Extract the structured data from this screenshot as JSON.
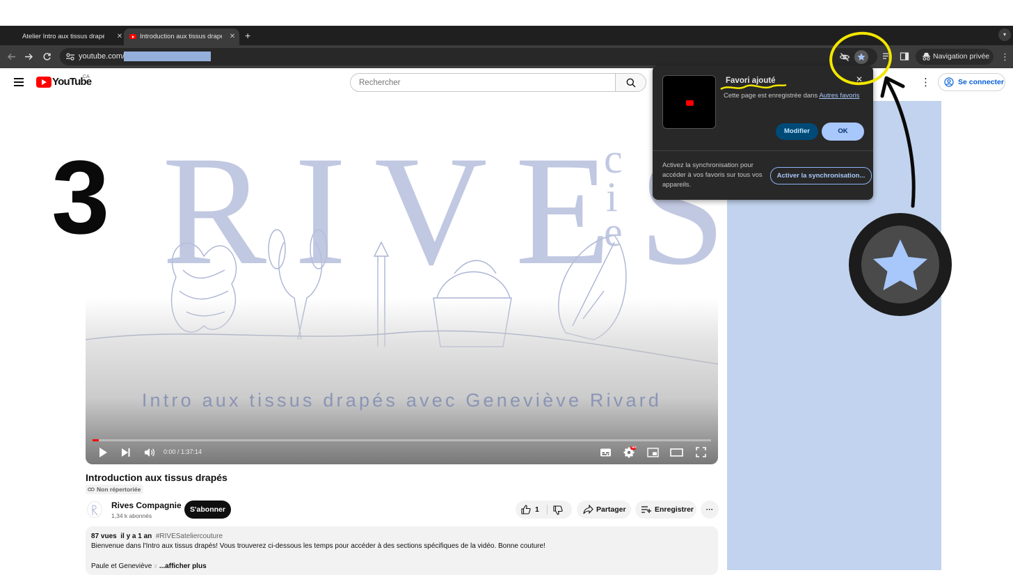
{
  "browser": {
    "tabs": [
      {
        "title": "Atelier Intro aux tissus drapés",
        "close": "✕"
      },
      {
        "title": "Introduction aux tissus drapés",
        "close": "✕"
      }
    ],
    "new_tab": "+",
    "url": "youtube.com/",
    "private_label": "Navigation privée"
  },
  "youtube": {
    "wordmark": "YouTube",
    "country": "CA",
    "search_placeholder": "Rechercher",
    "signin_label": "Se connecter"
  },
  "annotation": {
    "step_number": "3"
  },
  "player": {
    "subtitle_overlay": "Intro aux tissus drapés avec Geneviève Rivard",
    "watermark_word": "RIVES",
    "watermark_suffix": "cie",
    "time": "0:00 / 1:37:14",
    "progress_fraction": 0.01,
    "quality_badge": "HD"
  },
  "video": {
    "title": "Introduction aux tissus drapés",
    "visibility": "Non répertoriée",
    "channel": "Rives Compagnie",
    "subscribers": "1,34 k abonnés",
    "subscribe_label": "S'abonner",
    "likes": "1",
    "share_label": "Partager",
    "save_label": "Enregistrer",
    "more": "···"
  },
  "description": {
    "views_date": "87 vues  il y a 1 an  ",
    "hashtag": "#RIVESateliercouture",
    "text": "Bienvenue dans l'Intro aux tissus drapés! Vous trouverez ci-dessous les temps pour accéder à des sections spécifiques de la vidéo. Bonne couture!",
    "signature": "Paule et Geneviève ",
    "signature_mark": "x",
    "more_label": " ...afficher plus"
  },
  "bookmark_bubble": {
    "title": "Favori ajouté",
    "close": "✕",
    "description": "Cette page est enregistrée dans ",
    "folder_link": "Autres favoris",
    "edit_label": "Modifier",
    "ok_label": "OK",
    "sync_text": "Activez la synchronisation pour accéder à vos favoris sur tous vos appareils.",
    "sync_button": "Activer la synchronisation..."
  },
  "colors": {
    "accent_blue": "#a8c7fa",
    "annotation_yellow": "#f2e600",
    "side_column": "#c1d3ee",
    "youtube_red": "#ff0000"
  },
  "icons": [
    "back-icon",
    "forward-icon",
    "reload-icon",
    "site-info-icon",
    "eye-off-icon",
    "bookmark-star-icon",
    "reading-list-icon",
    "side-panel-icon",
    "incognito-icon",
    "menu-dots-icon",
    "hamburger-icon",
    "search-icon",
    "play-icon",
    "next-icon",
    "volume-icon",
    "subtitles-icon",
    "settings-icon",
    "miniplayer-icon",
    "theater-icon",
    "fullscreen-icon",
    "like-icon",
    "dislike-icon",
    "share-icon",
    "save-icon",
    "link-icon"
  ]
}
